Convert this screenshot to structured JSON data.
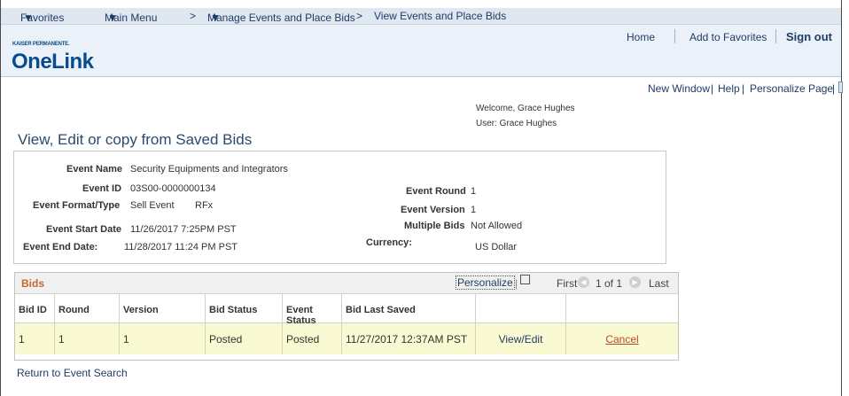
{
  "topnav": {
    "favorites": "Favorites",
    "main_menu": "Main Menu",
    "sep1": ">",
    "manage": "Manage Events and Place Bids",
    "sep2": ">",
    "current": "View Events and Place Bids"
  },
  "header": {
    "logo_small": "KAISER PERMANENTE.",
    "logo_big": "OneLink",
    "home": "Home",
    "add_favorites": "Add to Favorites",
    "sign_out": "Sign out"
  },
  "util": {
    "new_window": "New Window",
    "help": "Help",
    "personalize_page": "Personalize Page",
    "sep": "|"
  },
  "user": {
    "welcome": "Welcome, Grace Hughes",
    "user": "User: Grace Hughes"
  },
  "page_title": "View, Edit or copy from Saved Bids",
  "event": {
    "name_label": "Event Name",
    "name": "Security Equipments and Integrators",
    "id_label": "Event ID",
    "id": "03S00-0000000134",
    "format_label": "Event Format/Type",
    "format": "Sell Event",
    "type": "RFx",
    "start_label": "Event Start Date",
    "start": "11/26/2017  7:25PM PST",
    "end_label": "Event End Date:",
    "end": "11/28/2017 11:24 PM PST",
    "round_label": "Event Round",
    "round": "1",
    "version_label": "Event Version",
    "version": "1",
    "multiple_label": "Multiple Bids",
    "multiple": "Not Allowed",
    "currency_label": "Currency:",
    "currency": "US Dollar"
  },
  "bids": {
    "title": "Bids",
    "personalize": "Personalize",
    "first": "First",
    "count": "1 of 1",
    "last": "Last",
    "columns": [
      "Bid ID",
      "Round",
      "Version",
      "Bid Status",
      "Event Status",
      "Bid Last Saved",
      "",
      ""
    ],
    "row": {
      "bid_id": "1",
      "round": "1",
      "version": "1",
      "bid_status": "Posted",
      "event_status": "Posted",
      "last_saved": "11/27/2017 12:37AM PST",
      "view_edit": "View/Edit",
      "cancel": "Cancel"
    }
  },
  "return_link": "Return to Event Search",
  "colors": {
    "link": "#1f3c66",
    "grid_title": "#c0682d",
    "row_bg": "#fafad2",
    "brand": "#0a4c8b"
  }
}
